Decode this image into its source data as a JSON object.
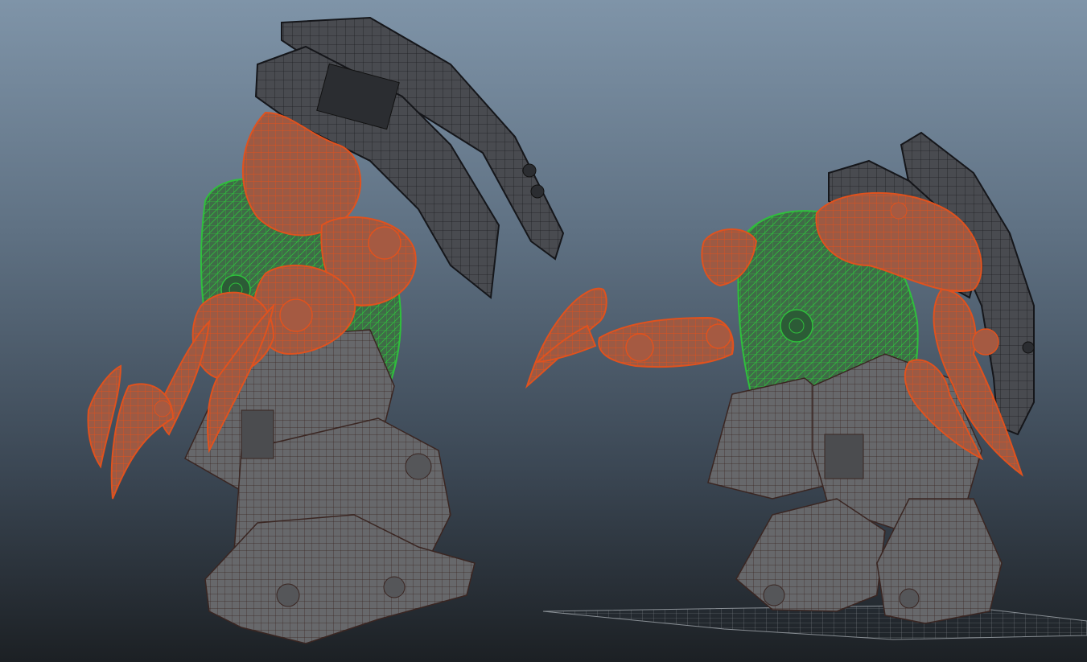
{
  "viewport": {
    "display_mode": "wireframe-on-shaded",
    "background_gradient": [
      "#7f94a8",
      "#5f7183",
      "#3c4855",
      "#1c2024"
    ]
  },
  "materials": {
    "armor_gray": "#4a4d52",
    "armor_dark": "#2d2f33",
    "selected_orange": "#e0521e",
    "orange_fill": "#a9593f",
    "green_wire": "#2fbf3c",
    "green_fill": "#3e6f47",
    "mech_brown_wire": "#6e3a30",
    "mech_gray_fill": "#6a6b6e"
  },
  "scene_objects": [
    {
      "name": "mech-left",
      "selection": "partial",
      "selected_parts": [
        "arms",
        "claws"
      ],
      "highlighted_parts": [
        "torso"
      ]
    },
    {
      "name": "mech-right",
      "selection": "partial",
      "selected_parts": [
        "arms",
        "claws"
      ],
      "highlighted_parts": [
        "torso"
      ]
    },
    {
      "name": "ground-grid",
      "visible": true
    }
  ]
}
